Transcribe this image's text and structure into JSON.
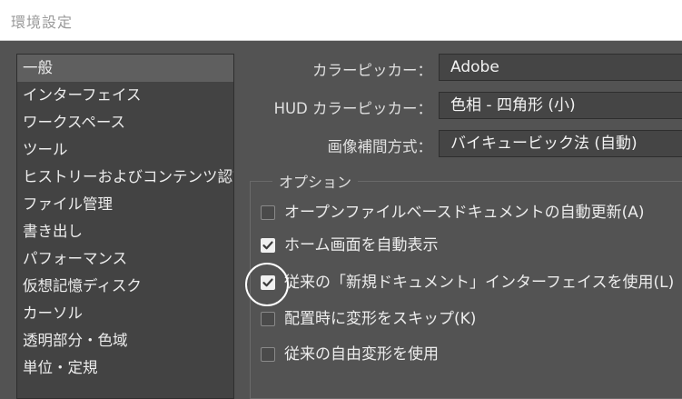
{
  "window": {
    "title": "環境設定"
  },
  "sidebar": {
    "items": [
      {
        "label": "一般",
        "selected": true
      },
      {
        "label": "インターフェイス"
      },
      {
        "label": "ワークスペース"
      },
      {
        "label": "ツール"
      },
      {
        "label": "ヒストリーおよびコンテンツ認証..."
      },
      {
        "label": "ファイル管理"
      },
      {
        "label": "書き出し"
      },
      {
        "label": "パフォーマンス"
      },
      {
        "label": "仮想記憶ディスク"
      },
      {
        "label": "カーソル"
      },
      {
        "label": "透明部分・色域"
      },
      {
        "label": "単位・定規"
      }
    ]
  },
  "fields": {
    "color_picker": {
      "label": "カラーピッカー：",
      "value": "Adobe"
    },
    "hud_color_picker": {
      "label": "HUD カラーピッカー：",
      "value": "色相 - 四角形 (小)"
    },
    "interpolation": {
      "label": "画像補間方式：",
      "value": "バイキュービック法 (自動)"
    }
  },
  "options": {
    "legend": "オプション",
    "items": [
      {
        "label": "オープンファイルベースドキュメントの自動更新(A)",
        "checked": false
      },
      {
        "label": "ホーム画面を自動表示",
        "checked": true
      },
      {
        "label": "従来の「新規ドキュメント」インターフェイスを使用(L)",
        "checked": true
      },
      {
        "label": "配置時に変形をスキップ(K)",
        "checked": false
      },
      {
        "label": "従来の自由変形を使用",
        "checked": false
      }
    ]
  },
  "colors": {
    "background": "#535353",
    "sidebar_bg": "#434343",
    "selected_item": "#5f5f5f",
    "titlebar_bg": "#ffffff",
    "checkbox_checked": "#f0f0f0"
  }
}
